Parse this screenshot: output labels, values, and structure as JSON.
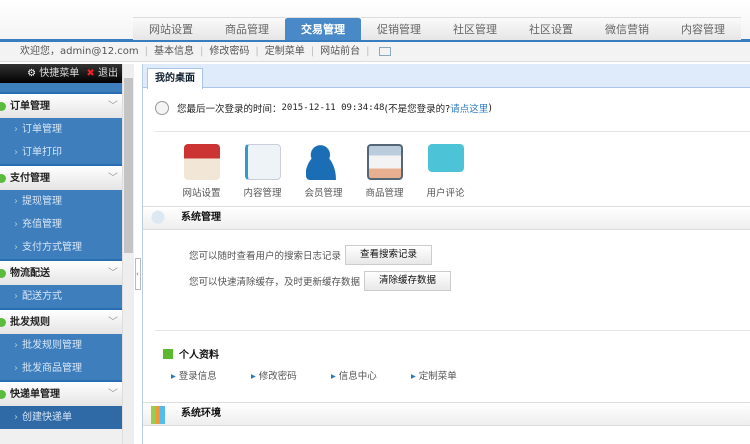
{
  "nav": {
    "tabs": [
      "网站设置",
      "商品管理",
      "交易管理",
      "促销管理",
      "社区管理",
      "社区设置",
      "微信营销",
      "内容管理"
    ],
    "active": 2
  },
  "infobar": {
    "welcome": "欢迎您，admin@12.com",
    "links": [
      "基本信息",
      "修改密码",
      "定制菜单",
      "网站前台"
    ]
  },
  "sidebar": {
    "shortcut": "快捷菜单",
    "logout": "退出",
    "groups": [
      {
        "title": "订单管理",
        "items": [
          "订单管理",
          "订单打印"
        ]
      },
      {
        "title": "支付管理",
        "items": [
          "提现管理",
          "充值管理",
          "支付方式管理"
        ]
      },
      {
        "title": "物流配送",
        "items": [
          "配送方式"
        ]
      },
      {
        "title": "批发规则",
        "items": [
          "批发规则管理",
          "批发商品管理"
        ]
      },
      {
        "title": "快递单管理",
        "items": [
          "创建快递单"
        ]
      }
    ]
  },
  "main": {
    "tab": "我的桌面",
    "login_prefix": "您最后一次登录的时间：",
    "login_time": "2015-12-11 09:34:48",
    "login_q": " (不是您登录的? ",
    "login_link": "请点这里",
    "login_end": ")",
    "quick": [
      "网站设置",
      "内容管理",
      "会员管理",
      "商品管理",
      "用户评论"
    ],
    "system": {
      "title": "系统管理",
      "row1": "您可以随时查看用户的搜索日志记录",
      "btn1": "查看搜索记录",
      "row2": "您可以快速清除缓存，及时更新缓存数据",
      "btn2": "清除缓存数据"
    },
    "profile": {
      "title": "个人资料",
      "links": [
        "登录信息",
        "修改密码",
        "信息中心",
        "定制菜单"
      ]
    },
    "env": {
      "title": "系统环境"
    }
  }
}
